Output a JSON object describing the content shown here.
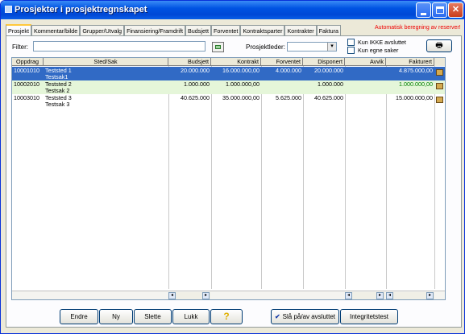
{
  "window": {
    "title": "Prosjekter i prosjektregnskapet"
  },
  "tabs": [
    "Prosjekt",
    "Kommentar/bilde",
    "Grupper/Utvalg",
    "Finansiering/Framdrift",
    "Budsjett",
    "Forventet",
    "Kontraktsparter",
    "Kontrakter",
    "Faktura"
  ],
  "active_tab": "Prosjekt",
  "auto_message": "Automatisk beregning av reserver!",
  "filter": {
    "label": "Filter:",
    "value": ""
  },
  "prosjektleder": {
    "label": "Prosjektleder:",
    "value": ""
  },
  "checkboxes": {
    "kun_ikke_avsluttet": "Kun IKKE avsluttet",
    "kun_egne_saker": "Kun egne saker"
  },
  "columns": [
    "Oppdrag",
    "Sted/Sak",
    "Budsjett",
    "Kontrakt",
    "Forventet",
    "Disponert",
    "Avvik",
    "Fakturert"
  ],
  "rows": [
    {
      "oppdrag": "10001010",
      "sted": "Teststed 1",
      "sak": "Testsak1",
      "budsjett": "20.000.000",
      "kontrakt": "16.000.000,00",
      "forventet": "4.000.000",
      "disponert": "20.000.000",
      "avvik": "",
      "fakturert": "4.875.000,00"
    },
    {
      "oppdrag": "10002010",
      "sted": "Teststed 2",
      "sak": "Testsak 2",
      "budsjett": "1.000.000",
      "kontrakt": "1.000.000,00",
      "forventet": "",
      "disponert": "1.000.000",
      "avvik": "",
      "fakturert": "1.000.000,00"
    },
    {
      "oppdrag": "10003010",
      "sted": "Teststed 3",
      "sak": "Testsak 3",
      "budsjett": "40.625.000",
      "kontrakt": "35.000.000,00",
      "forventet": "5.625.000",
      "disponert": "40.625.000",
      "avvik": "",
      "fakturert": "15.000.000,00"
    }
  ],
  "buttons": {
    "endre": "Endre",
    "ny": "Ny",
    "slette": "Slette",
    "lukk": "Lukk",
    "help": "?",
    "sla_av": "Slå på/av avsluttet",
    "integritet": "Integritetstest"
  },
  "colors": {
    "titlebar": "#0054e3",
    "selected_row": "#316ac5",
    "alt_row": "#e5f6d9",
    "fakturert_green": "#008000",
    "alert_red": "#e00000"
  }
}
